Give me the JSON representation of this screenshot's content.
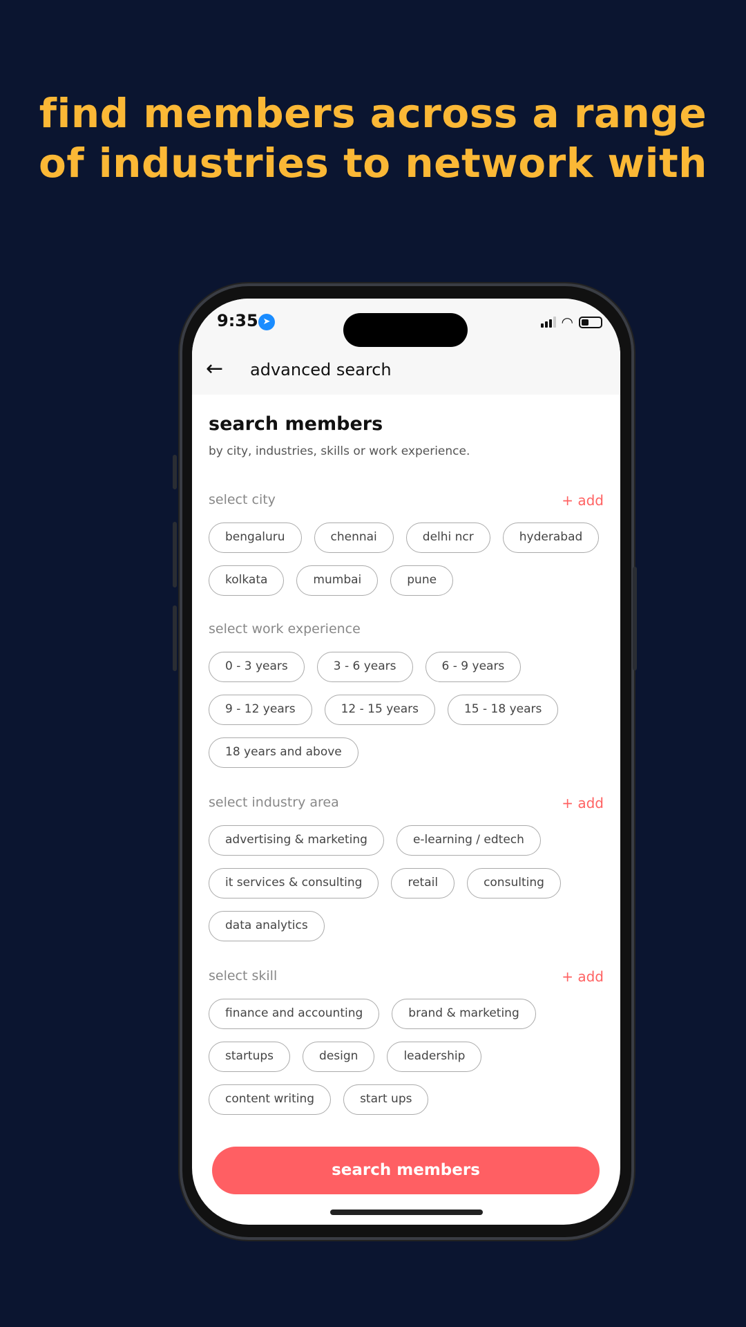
{
  "headline": {
    "line1": "find members across a range",
    "line2": "of industries to network with"
  },
  "status": {
    "time": "9:35",
    "location_icon": "location-arrow-icon"
  },
  "header": {
    "title": "advanced search",
    "back_icon": "arrow-left-icon"
  },
  "main": {
    "title": "search members",
    "subtitle": "by city, industries, skills or work experience.",
    "sections": [
      {
        "title": "select city",
        "add": "+ add",
        "chips": [
          "bengaluru",
          "chennai",
          "delhi ncr",
          "hyderabad",
          "kolkata",
          "mumbai",
          "pune"
        ]
      },
      {
        "title": "select work experience",
        "chips": [
          "0 - 3 years",
          "3 - 6 years",
          "6 - 9 years",
          "9 - 12 years",
          "12 - 15 years",
          "15 - 18 years",
          "18 years and above"
        ]
      },
      {
        "title": "select industry area",
        "add": "+ add",
        "chips": [
          "advertising & marketing",
          "e-learning / edtech",
          "it services & consulting",
          "retail",
          "consulting",
          "data analytics"
        ]
      },
      {
        "title": "select skill",
        "add": "+ add",
        "chips": [
          "finance and accounting",
          "brand & marketing",
          "startups",
          "design",
          "leadership",
          "content writing",
          "start ups"
        ]
      }
    ]
  },
  "cta": {
    "label": "search members"
  },
  "colors": {
    "background": "#0b1530",
    "headline": "#fbb836",
    "accent": "#ff5f63"
  }
}
